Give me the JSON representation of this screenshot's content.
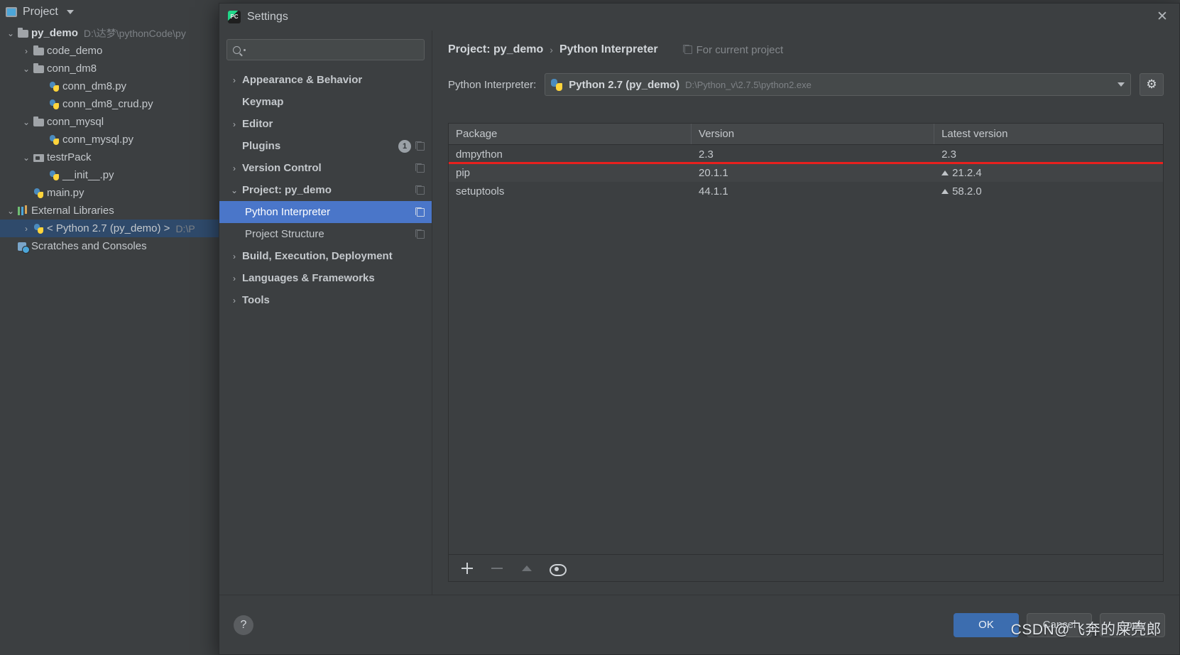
{
  "ide": {
    "project_panel": {
      "title": "Project",
      "icon": "project-window-icon",
      "caret": "chevron-down-icon",
      "tree": [
        {
          "label": "py_demo",
          "path": "D:\\达梦\\pythonCode\\py",
          "icon": "folder",
          "indent": 0,
          "arrow": "v",
          "bold": true,
          "selected": false
        },
        {
          "label": "code_demo",
          "path": "",
          "icon": "folder",
          "indent": 1,
          "arrow": ">",
          "bold": false,
          "selected": false
        },
        {
          "label": "conn_dm8",
          "path": "",
          "icon": "folder",
          "indent": 1,
          "arrow": "v",
          "bold": false,
          "selected": false
        },
        {
          "label": "conn_dm8.py",
          "path": "",
          "icon": "python-file",
          "indent": 2,
          "arrow": "",
          "bold": false,
          "selected": false
        },
        {
          "label": "conn_dm8_crud.py",
          "path": "",
          "icon": "python-file",
          "indent": 2,
          "arrow": "",
          "bold": false,
          "selected": false
        },
        {
          "label": "conn_mysql",
          "path": "",
          "icon": "folder",
          "indent": 1,
          "arrow": "v",
          "bold": false,
          "selected": false
        },
        {
          "label": "conn_mysql.py",
          "path": "",
          "icon": "python-file",
          "indent": 2,
          "arrow": "",
          "bold": false,
          "selected": false
        },
        {
          "label": "testrPack",
          "path": "",
          "icon": "folder-package",
          "indent": 1,
          "arrow": "v",
          "bold": false,
          "selected": false
        },
        {
          "label": "__init__.py",
          "path": "",
          "icon": "python-file",
          "indent": 2,
          "arrow": "",
          "bold": false,
          "selected": false
        },
        {
          "label": "main.py",
          "path": "",
          "icon": "python-file",
          "indent": 1,
          "arrow": "",
          "bold": false,
          "selected": false
        },
        {
          "label": "External Libraries",
          "path": "",
          "icon": "library",
          "indent": 0,
          "arrow": "v",
          "bold": false,
          "selected": false
        },
        {
          "label": "< Python 2.7 (py_demo) >",
          "path": "D:\\P",
          "icon": "python-file",
          "indent": 1,
          "arrow": ">",
          "bold": false,
          "selected": true
        },
        {
          "label": "Scratches and Consoles",
          "path": "",
          "icon": "scratch",
          "indent": 0,
          "arrow": "",
          "bold": false,
          "selected": false
        }
      ]
    }
  },
  "dialog": {
    "title": "Settings",
    "title_icon": "pycharm-logo-icon",
    "close_icon": "close-icon",
    "search": {
      "placeholder": "",
      "value": "",
      "icon": "search-icon"
    },
    "settings_tree": [
      {
        "label": "Appearance & Behavior",
        "arrow": ">",
        "child": false,
        "selected": false,
        "badge": "",
        "copy_icon": false
      },
      {
        "label": "Keymap",
        "arrow": "",
        "child": false,
        "selected": false,
        "badge": "",
        "copy_icon": false
      },
      {
        "label": "Editor",
        "arrow": ">",
        "child": false,
        "selected": false,
        "badge": "",
        "copy_icon": false
      },
      {
        "label": "Plugins",
        "arrow": "",
        "child": false,
        "selected": false,
        "badge": "1",
        "copy_icon": true
      },
      {
        "label": "Version Control",
        "arrow": ">",
        "child": false,
        "selected": false,
        "badge": "",
        "copy_icon": true
      },
      {
        "label": "Project: py_demo",
        "arrow": "v",
        "child": false,
        "selected": false,
        "badge": "",
        "copy_icon": true
      },
      {
        "label": "Python Interpreter",
        "arrow": "",
        "child": true,
        "selected": true,
        "badge": "",
        "copy_icon": true
      },
      {
        "label": "Project Structure",
        "arrow": "",
        "child": true,
        "selected": false,
        "badge": "",
        "copy_icon": true
      },
      {
        "label": "Build, Execution, Deployment",
        "arrow": ">",
        "child": false,
        "selected": false,
        "badge": "",
        "copy_icon": false
      },
      {
        "label": "Languages & Frameworks",
        "arrow": ">",
        "child": false,
        "selected": false,
        "badge": "",
        "copy_icon": false
      },
      {
        "label": "Tools",
        "arrow": ">",
        "child": false,
        "selected": false,
        "badge": "",
        "copy_icon": false
      }
    ],
    "breadcrumb": {
      "part1": "Project: py_demo",
      "separator": "›",
      "part2": "Python Interpreter",
      "note": "For current project",
      "note_icon": "copy-icon"
    },
    "interpreter": {
      "label": "Python Interpreter:",
      "icon": "python-icon",
      "name": "Python 2.7 (py_demo)",
      "path": "D:\\Python_v\\2.7.5\\python2.exe",
      "caret": "chevron-down-icon",
      "gear_icon": "gear-icon"
    },
    "packages_table": {
      "columns": [
        "Package",
        "Version",
        "Latest version"
      ],
      "rows": [
        {
          "package": "dmpython",
          "version": "2.3",
          "latest": "2.3",
          "upgrade": false,
          "highlighted": true
        },
        {
          "package": "pip",
          "version": "20.1.1",
          "latest": "21.2.4",
          "upgrade": true,
          "highlighted": false
        },
        {
          "package": "setuptools",
          "version": "44.1.1",
          "latest": "58.2.0",
          "upgrade": true,
          "highlighted": false
        }
      ],
      "toolbar": [
        {
          "icon": "plus-icon",
          "enabled": true
        },
        {
          "icon": "minus-icon",
          "enabled": false
        },
        {
          "icon": "upgrade-arrow-icon",
          "enabled": false
        },
        {
          "icon": "eye-icon",
          "enabled": true
        }
      ]
    },
    "footer": {
      "help_label": "?",
      "ok_label": "OK",
      "cancel_label": "Cancel",
      "apply_label": "Apply"
    }
  },
  "watermark": {
    "text": "CSDN@飞奔的屎壳郎"
  },
  "colors": {
    "accent_blue": "#4a76c9",
    "primary_button": "#3c6daf",
    "highlight_red": "#e8201e",
    "dialog_bg": "#3c3f41",
    "tree_selected": "#2f4a6b"
  }
}
